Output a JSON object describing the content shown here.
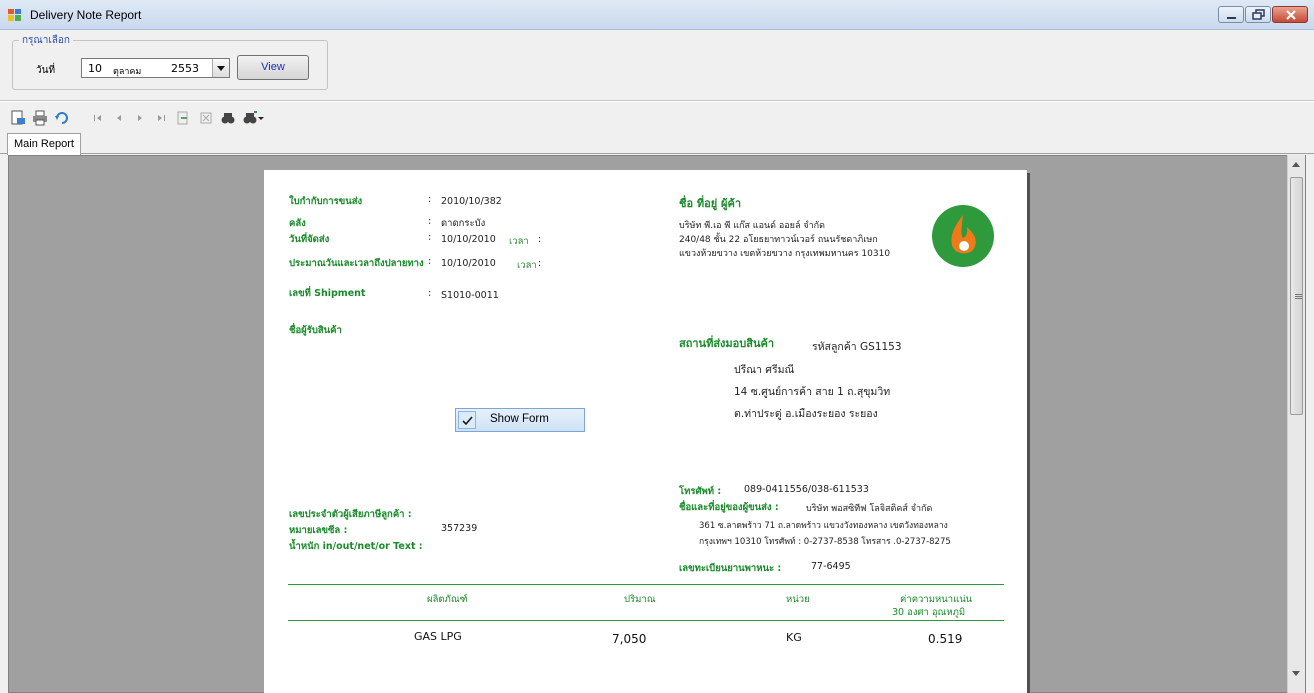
{
  "window": {
    "title": "Delivery Note Report",
    "icon": "app-window-icon"
  },
  "filter": {
    "group_label": "กรุณาเลือก",
    "date_label": "วันที่",
    "date_day": "10",
    "date_month": "ตุลาคม",
    "date_year": "2553",
    "view_button": "View"
  },
  "toolbar": {
    "icons": [
      "export-icon",
      "print-icon",
      "refresh-icon",
      "first-page-icon",
      "previous-page-icon",
      "next-page-icon",
      "last-page-icon",
      "goto-page-icon",
      "close-icon",
      "find-icon",
      "zoom-icon"
    ]
  },
  "tabs": [
    "Main Report"
  ],
  "report": {
    "left": {
      "delivery_label": "ใบกำกับการขนส่ง",
      "delivery_value": "2010/10/382",
      "warehouse_label": "คลัง",
      "warehouse_value": "ดาดกระบัง",
      "ship_date_label": "วันที่จัดส่ง",
      "ship_date_value": "10/10/2010",
      "time_label": "เวลา",
      "eta_label": "ประมาณวันและเวลาถึงปลายทาง",
      "eta_value": "10/10/2010",
      "shipment_label": "เลขที่ Shipment",
      "shipment_value": "S1010-0011",
      "receiver_label": "ชื่อผู้รับสินค้า",
      "taxid_label": "เลขประจำตัวผู้เสียภาษีลูกค้า :",
      "seal_label": "หมายเลขซีล :",
      "seal_value": "357239",
      "weight_label": "น้ำหนัก in/out/net/or Text :"
    },
    "right": {
      "vendor_label": "ชื่อ ที่อยู่ ผู้ค้า",
      "vendor_line1": "บริษัท พี.เอ พี แก๊ส แอนด์ ออยล์ จำกัด",
      "vendor_line2": "240/48 ชั้น 22 อโยธยาทาวน์เวอร์ ถนนรัชดาภิเษก",
      "vendor_line3": "แขวงห้วยขวาง เขตห้วยขวาง กรุงเทพมหานคร 10310",
      "delivery_place_label": "สถานที่ส่งมอบสินค้า",
      "customer_code": "รหัสลูกค้า GS1153",
      "customer_name": "ปรีณา ศรีมณี",
      "address1": "14 ซ.ศูนย์การค้า สาย 1 ถ.สุขุมวิท",
      "address2": "ต.ท่าประดู่ อ.เมืองระยอง ระยอง",
      "phone_label": "โทรศัพท์ :",
      "phone_value": "089-0411556/038-611533",
      "carrier_label": "ชื่อและที่อยู่ของผู้ขนส่ง :",
      "carrier_name": "บริษัท พอสซิทีฟ โลจิสติคส์ จำกัด",
      "carrier_line1": "361 ซ.ลาดพร้าว 71 ถ.ลาดพร้าว แขวงวังทองหลาง เขตวังทองหลาง",
      "carrier_line2": "กรุงเทพฯ 10310 โทรศัพท์ : 0-2737-8538 โทรสาร .0-2737-8275",
      "vehicle_label": "เลขทะเบียนยานพาหนะ :",
      "vehicle_value": "77-6495"
    },
    "table": {
      "headers": [
        "ผลิตภัณฑ์",
        "ปริมาณ",
        "หน่วย",
        "ค่าความหนาแน่น"
      ],
      "density_sub": "30 องศา  อุณหภูมิ",
      "rows": [
        {
          "product": "GAS LPG",
          "qty": "7,050",
          "unit": "KG",
          "density": "0.519"
        }
      ]
    }
  },
  "overlay": {
    "show_form_label": "Show Form"
  },
  "colors": {
    "accent_green": "#1a8a2a",
    "logo_flame": "#f07a1a"
  }
}
